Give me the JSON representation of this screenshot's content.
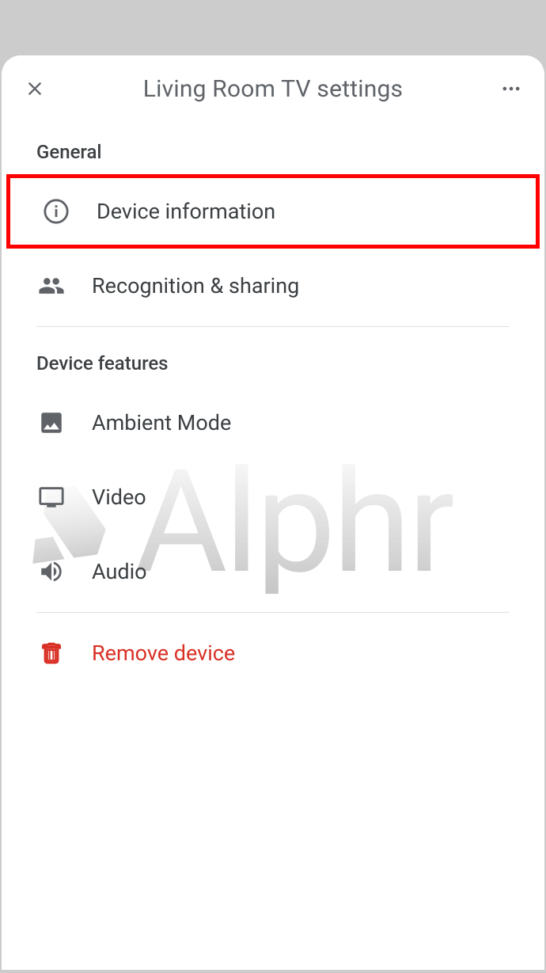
{
  "header": {
    "title": "Living Room TV settings"
  },
  "sections": {
    "general": {
      "label": "General",
      "items": {
        "device_information": "Device information",
        "recognition_sharing": "Recognition & sharing"
      }
    },
    "device_features": {
      "label": "Device features",
      "items": {
        "ambient_mode": "Ambient Mode",
        "video": "Video",
        "audio": "Audio"
      }
    }
  },
  "remove": {
    "label": "Remove device"
  },
  "watermark": {
    "text": "Alphr"
  }
}
